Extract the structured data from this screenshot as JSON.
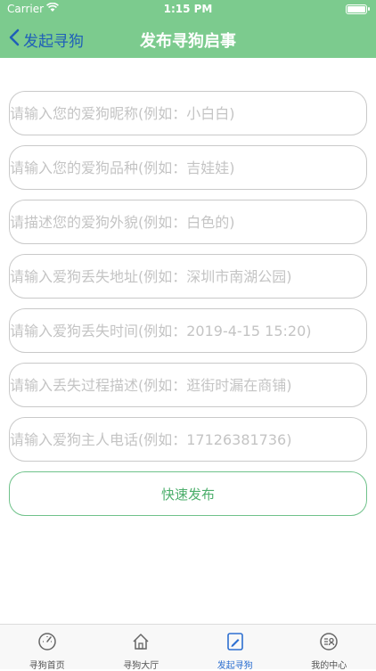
{
  "status_bar": {
    "carrier": "Carrier",
    "time": "1:15 PM"
  },
  "nav": {
    "back_label": "发起寻狗",
    "title": "发布寻狗启事"
  },
  "form": {
    "fields": [
      {
        "placeholder": "请输入您的爱狗昵称(例如：小白白)"
      },
      {
        "placeholder": "请输入您的爱狗品种(例如：吉娃娃)"
      },
      {
        "placeholder": "请描述您的爱狗外貌(例如：白色的)"
      },
      {
        "placeholder": "请输入爱狗丢失地址(例如：深圳市南湖公园)"
      },
      {
        "placeholder": "请输入爱狗丢失时间(例如：2019-4-15 15:20)"
      },
      {
        "placeholder": "请输入丢失过程描述(例如：逛街时漏在商铺)"
      },
      {
        "placeholder": "请输入爱狗主人电话(例如：17126381736)"
      }
    ],
    "submit_label": "快速发布"
  },
  "tabbar": {
    "items": [
      {
        "label": "寻狗首页",
        "icon": "dashboard-icon"
      },
      {
        "label": "寻狗大厅",
        "icon": "home-icon"
      },
      {
        "label": "发起寻狗",
        "icon": "edit-icon",
        "active": true
      },
      {
        "label": "我的中心",
        "icon": "profile-icon"
      }
    ]
  },
  "colors": {
    "header_bg": "#7ccb8e",
    "back_text": "#1f5fb8",
    "submit_text": "#4cae6b",
    "tab_active": "#2d6fd1"
  }
}
